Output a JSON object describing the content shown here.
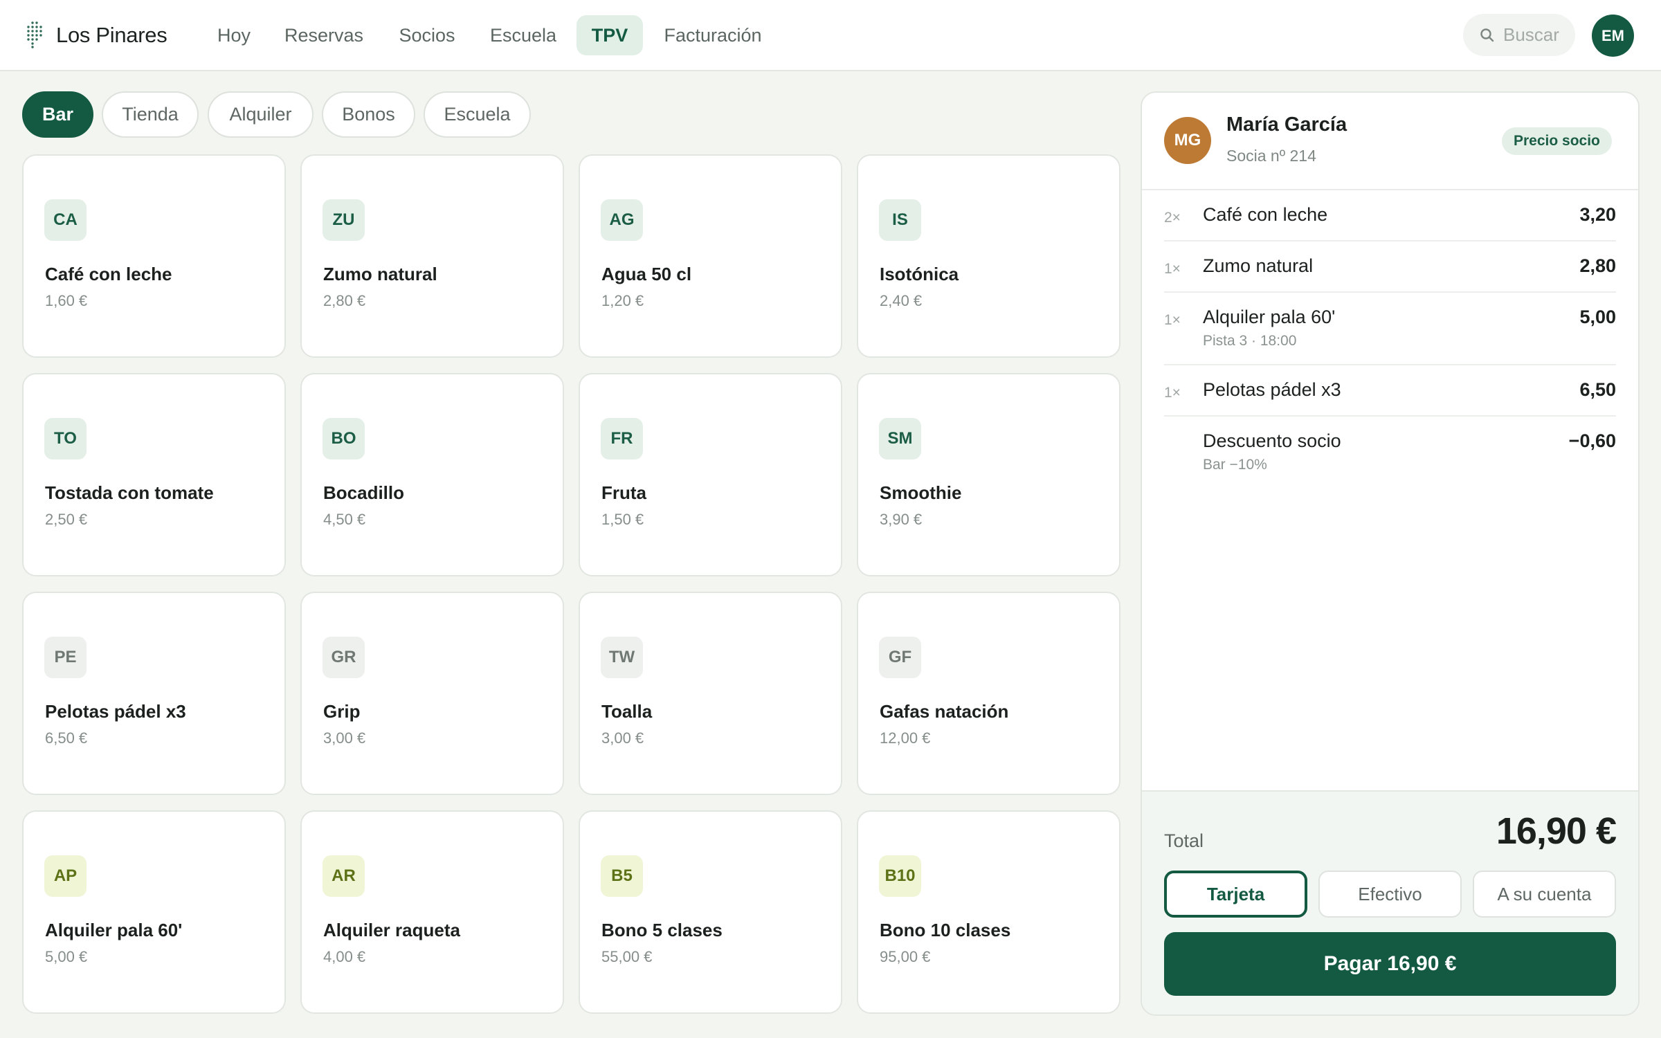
{
  "brand": {
    "name": "Los Pinares",
    "icon": "pine-dots-logo"
  },
  "nav": {
    "items": [
      {
        "label": "Hoy"
      },
      {
        "label": "Reservas"
      },
      {
        "label": "Socios"
      },
      {
        "label": "Escuela"
      },
      {
        "label": "TPV",
        "active": true
      },
      {
        "label": "Facturación"
      }
    ]
  },
  "search": {
    "placeholder": "Buscar",
    "icon": "search-icon"
  },
  "user": {
    "initials": "EM"
  },
  "categories": [
    {
      "label": "Bar",
      "active": true
    },
    {
      "label": "Tienda"
    },
    {
      "label": "Alquiler"
    },
    {
      "label": "Bonos"
    },
    {
      "label": "Escuela"
    }
  ],
  "products": [
    {
      "code": "CA",
      "name": "Café con leche",
      "price": "1,60 €",
      "tone": "green"
    },
    {
      "code": "ZU",
      "name": "Zumo natural",
      "price": "2,80 €",
      "tone": "green"
    },
    {
      "code": "AG",
      "name": "Agua 50 cl",
      "price": "1,20 €",
      "tone": "green"
    },
    {
      "code": "IS",
      "name": "Isotónica",
      "price": "2,40 €",
      "tone": "green"
    },
    {
      "code": "TO",
      "name": "Tostada con tomate",
      "price": "2,50 €",
      "tone": "green"
    },
    {
      "code": "BO",
      "name": "Bocadillo",
      "price": "4,50 €",
      "tone": "green"
    },
    {
      "code": "FR",
      "name": "Fruta",
      "price": "1,50 €",
      "tone": "green"
    },
    {
      "code": "SM",
      "name": "Smoothie",
      "price": "3,90 €",
      "tone": "green"
    },
    {
      "code": "PE",
      "name": "Pelotas pádel x3",
      "price": "6,50 €",
      "tone": "gray"
    },
    {
      "code": "GR",
      "name": "Grip",
      "price": "3,00 €",
      "tone": "gray"
    },
    {
      "code": "TW",
      "name": "Toalla",
      "price": "3,00 €",
      "tone": "gray"
    },
    {
      "code": "GF",
      "name": "Gafas natación",
      "price": "12,00 €",
      "tone": "gray"
    },
    {
      "code": "AP",
      "name": "Alquiler pala 60'",
      "price": "5,00 €",
      "tone": "lime"
    },
    {
      "code": "AR",
      "name": "Alquiler raqueta",
      "price": "4,00 €",
      "tone": "lime"
    },
    {
      "code": "B5",
      "name": "Bono 5 clases",
      "price": "55,00 €",
      "tone": "lime"
    },
    {
      "code": "B10",
      "name": "Bono 10 clases",
      "price": "95,00 €",
      "tone": "lime"
    }
  ],
  "order": {
    "customer": {
      "initials": "MG",
      "name": "María García",
      "member": "Socia nº 214",
      "badge": "Precio socio"
    },
    "lines": [
      {
        "qty": "2×",
        "name": "Café con leche",
        "sub": "",
        "amount": "3,20"
      },
      {
        "qty": "1×",
        "name": "Zumo natural",
        "sub": "",
        "amount": "2,80"
      },
      {
        "qty": "1×",
        "name": "Alquiler pala 60'",
        "sub": "Pista 3 · 18:00",
        "amount": "5,00"
      },
      {
        "qty": "1×",
        "name": "Pelotas pádel x3",
        "sub": "",
        "amount": "6,50"
      },
      {
        "qty": "",
        "name": "Descuento socio",
        "sub": "Bar −10%",
        "amount": "−0,60"
      }
    ],
    "total_label": "Total",
    "total_value": "16,90 €",
    "payment_methods": [
      {
        "label": "Tarjeta",
        "active": true
      },
      {
        "label": "Efectivo"
      },
      {
        "label": "A su cuenta"
      }
    ],
    "pay_label": "Pagar 16,90 €"
  },
  "colors": {
    "brand_green": "#145a43",
    "background": "#f3f5f1",
    "customer_avatar": "#bd7a34"
  }
}
